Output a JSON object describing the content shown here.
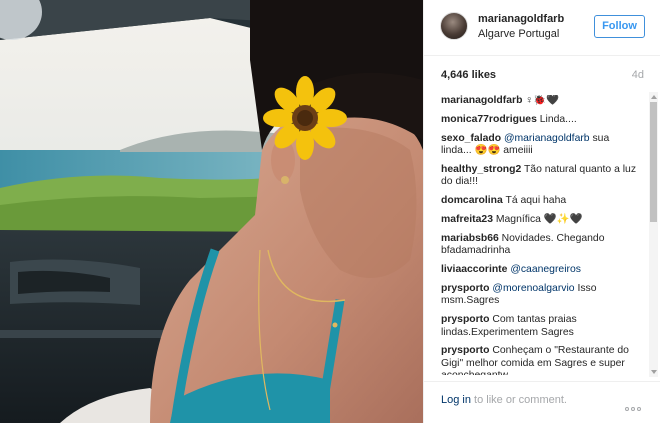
{
  "post": {
    "username": "marianagoldfarb",
    "location": "Algarve Portugal",
    "follow_label": "Follow",
    "likes": "4,646 likes",
    "age": "4d"
  },
  "comments": [
    {
      "user": "marianagoldfarb",
      "pre": "",
      "mention": "",
      "text": " ♀🐞🖤"
    },
    {
      "user": "monica77rodrigues",
      "pre": "",
      "mention": "",
      "text": " Linda...."
    },
    {
      "user": "sexo_falado",
      "pre": " ",
      "mention": "@marianagoldfarb",
      "text": " sua linda... 😍😍 ameiiii"
    },
    {
      "user": "healthy_strong2",
      "pre": "",
      "mention": "",
      "text": " Tão natural quanto a luz do dia!!!"
    },
    {
      "user": "domcarolina",
      "pre": "",
      "mention": "",
      "text": " Tá aqui haha"
    },
    {
      "user": "mafreita23",
      "pre": "",
      "mention": "",
      "text": " Magnífica 🖤✨🖤"
    },
    {
      "user": "mariabsb66",
      "pre": "",
      "mention": "",
      "text": " Novidades. Chegando bfadamadrinha"
    },
    {
      "user": "liviaaccorinte",
      "pre": " ",
      "mention": "@caanegreiros",
      "text": ""
    },
    {
      "user": "prysporto",
      "pre": " ",
      "mention": "@morenoalgarvio",
      "text": " Isso msm.Sagres"
    },
    {
      "user": "prysporto",
      "pre": "",
      "mention": "",
      "text": " Com tantas praias lindas.Experimentem Sagres"
    },
    {
      "user": "prysporto",
      "pre": "",
      "mention": "",
      "text": " Conheçam o \"Restaurante do Gigi\" melhor comida em Sagres e super aconchegantw"
    }
  ],
  "footer": {
    "login_link": "Log in",
    "login_text": " to like or comment."
  },
  "icons": {
    "more": "more-options-icon",
    "avatar": "profile-avatar"
  },
  "colors": {
    "accent": "#3897f0",
    "link": "#003569",
    "muted": "#a5a7aa",
    "text": "#262626"
  }
}
